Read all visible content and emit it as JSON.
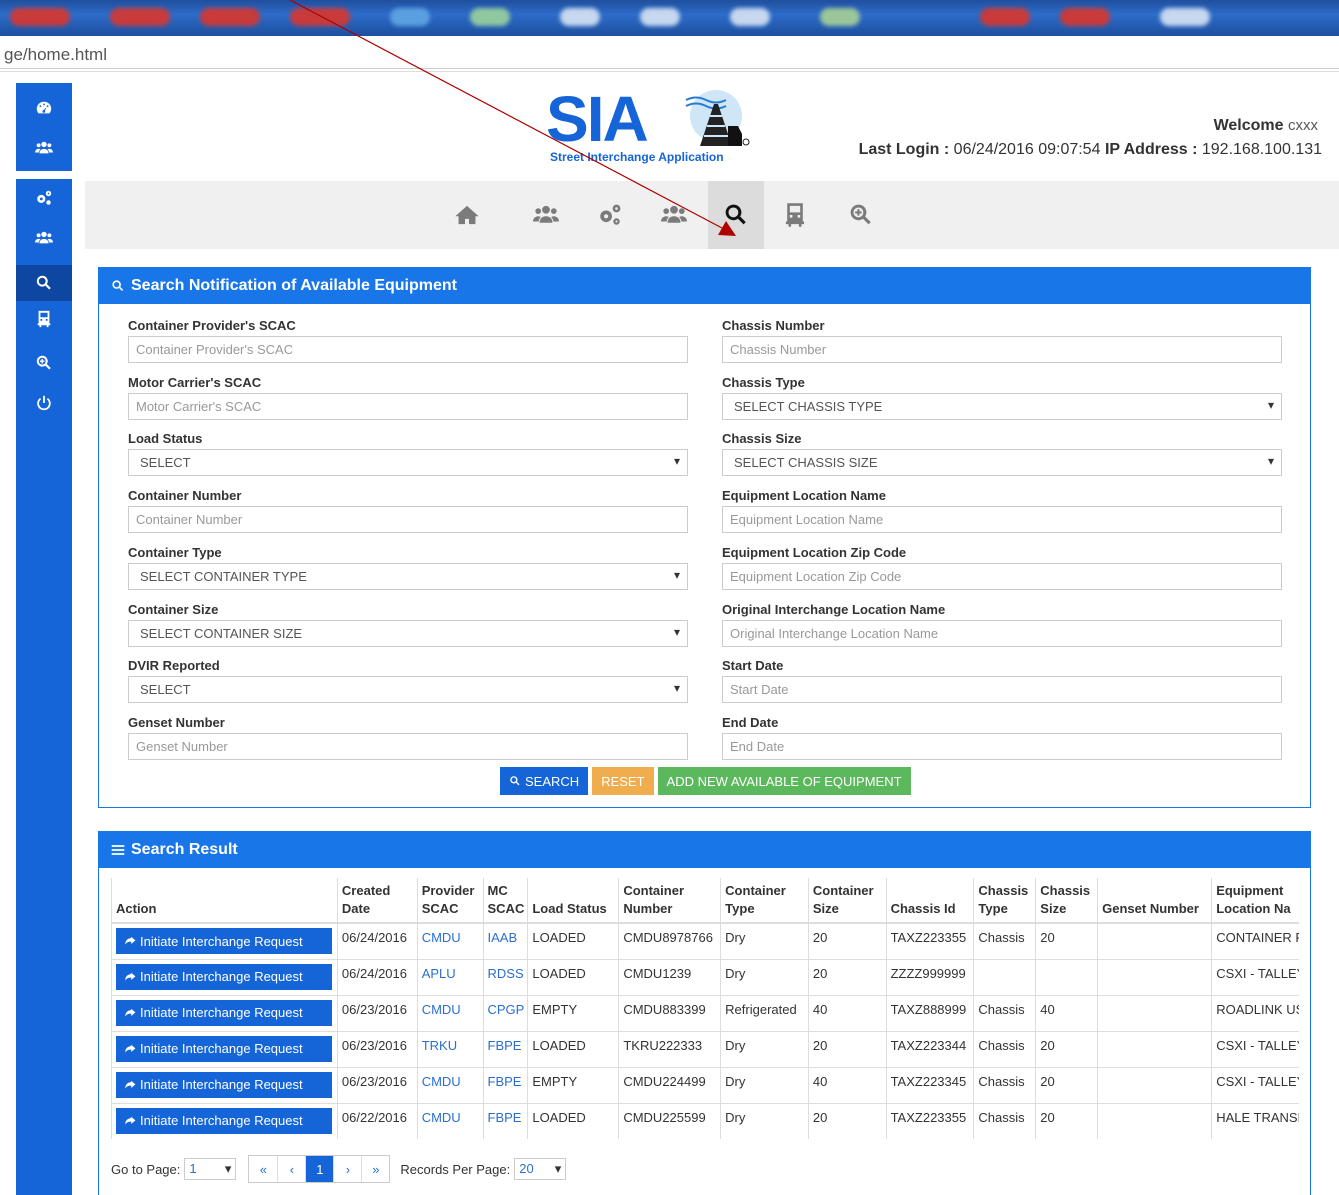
{
  "browser": {
    "address": "ge/home.html"
  },
  "sidebar": {
    "items": [
      {
        "icon": "dashboard-icon",
        "active": false
      },
      {
        "icon": "users-icon",
        "active": false
      },
      {
        "icon": "gears-icon",
        "active": false
      },
      {
        "icon": "users-icon",
        "active": false
      },
      {
        "icon": "search-icon",
        "active": true
      },
      {
        "icon": "truck-icon",
        "active": false
      },
      {
        "icon": "zoom-in-icon",
        "active": false
      },
      {
        "icon": "power-icon",
        "active": false
      }
    ]
  },
  "header": {
    "logo_text": "SIA",
    "logo_tagline": "Street Interchange Application",
    "welcome_label": "Welcome",
    "welcome_user": "cxxx",
    "last_login_label": "Last Login :",
    "last_login_value": "06/24/2016 09:07:54",
    "ip_label": "IP Address :",
    "ip_value": "192.168.100.131"
  },
  "navbar": {
    "items": [
      {
        "icon": "home-icon"
      },
      {
        "icon": "users-icon"
      },
      {
        "icon": "gears-icon"
      },
      {
        "icon": "users-icon"
      },
      {
        "icon": "search-icon",
        "active": true
      },
      {
        "icon": "truck-icon"
      },
      {
        "icon": "zoom-in-icon"
      }
    ]
  },
  "search_panel": {
    "title": "Search Notification of Available Equipment",
    "left_fields": [
      {
        "label": "Container Provider's SCAC",
        "type": "input",
        "placeholder": "Container Provider's SCAC"
      },
      {
        "label": "Motor Carrier's SCAC",
        "type": "input",
        "placeholder": "Motor Carrier's SCAC"
      },
      {
        "label": "Load Status",
        "type": "select",
        "value": "SELECT"
      },
      {
        "label": "Container Number",
        "type": "input",
        "placeholder": "Container Number"
      },
      {
        "label": "Container Type",
        "type": "select",
        "value": "SELECT CONTAINER TYPE"
      },
      {
        "label": "Container Size",
        "type": "select",
        "value": "SELECT CONTAINER SIZE"
      },
      {
        "label": "DVIR Reported",
        "type": "select",
        "value": "SELECT"
      },
      {
        "label": "Genset Number",
        "type": "input",
        "placeholder": "Genset Number"
      }
    ],
    "right_fields": [
      {
        "label": "Chassis Number",
        "type": "input",
        "placeholder": "Chassis Number"
      },
      {
        "label": "Chassis Type",
        "type": "select",
        "value": "SELECT CHASSIS TYPE"
      },
      {
        "label": "Chassis Size",
        "type": "select",
        "value": "SELECT CHASSIS SIZE"
      },
      {
        "label": "Equipment Location Name",
        "type": "input",
        "placeholder": "Equipment Location Name"
      },
      {
        "label": "Equipment Location Zip Code",
        "type": "input",
        "placeholder": "Equipment Location Zip Code"
      },
      {
        "label": "Original Interchange Location Name",
        "type": "input",
        "placeholder": "Original Interchange Location Name"
      },
      {
        "label": "Start Date",
        "type": "input",
        "placeholder": "Start Date"
      },
      {
        "label": "End Date",
        "type": "input",
        "placeholder": "End Date"
      }
    ],
    "search_label": "SEARCH",
    "reset_label": "RESET",
    "add_label": "ADD NEW AVAILABLE OF EQUIPMENT"
  },
  "result_panel": {
    "title": "Search Result",
    "columns": [
      "Action",
      "Created Date",
      "Provider SCAC",
      "MC SCAC",
      "Load Status",
      "Container Number",
      "Container Type",
      "Container Size",
      "Chassis Id",
      "Chassis Type",
      "Chassis Size",
      "Genset Number",
      "Equipment Location Na"
    ],
    "action_label": "Initiate Interchange Request",
    "rows": [
      [
        "06/24/2016",
        "CMDU",
        "IAAB",
        "LOADED",
        "CMDU8978766",
        "Dry",
        "20",
        "TAXZ223355",
        "Chassis",
        "20",
        "",
        "CONTAINER F"
      ],
      [
        "06/24/2016",
        "APLU",
        "RDSS",
        "LOADED",
        "CMDU1239",
        "Dry",
        "20",
        "ZZZZ999999",
        "",
        "",
        "",
        "CSXI - TALLEY"
      ],
      [
        "06/23/2016",
        "CMDU",
        "CPGP",
        "EMPTY",
        "CMDU883399",
        "Refrigerated",
        "40",
        "TAXZ888999",
        "Chassis",
        "40",
        "",
        "ROADLINK US"
      ],
      [
        "06/23/2016",
        "TRKU",
        "FBPE",
        "LOADED",
        "TKRU222333",
        "Dry",
        "20",
        "TAXZ223344",
        "Chassis",
        "20",
        "",
        "CSXI - TALLEY"
      ],
      [
        "06/23/2016",
        "CMDU",
        "FBPE",
        "EMPTY",
        "CMDU224499",
        "Dry",
        "40",
        "TAXZ223345",
        "Chassis",
        "20",
        "",
        "CSXI - TALLEY"
      ],
      [
        "06/22/2016",
        "CMDU",
        "FBPE",
        "LOADED",
        "CMDU225599",
        "Dry",
        "20",
        "TAXZ223355",
        "Chassis",
        "20",
        "",
        "HALE TRANSF"
      ]
    ],
    "pager": {
      "goto_label": "Go to Page:",
      "goto_value": "1",
      "first": "«",
      "prev": "‹",
      "current": "1",
      "next": "›",
      "last": "»",
      "records_label": "Records Per Page:",
      "records_value": "20"
    }
  },
  "colors": {
    "primary": "#1565d8",
    "panel": "#1976e8",
    "reset": "#f0ad4e",
    "add": "#5cb85c",
    "arrow": "#b00000"
  }
}
